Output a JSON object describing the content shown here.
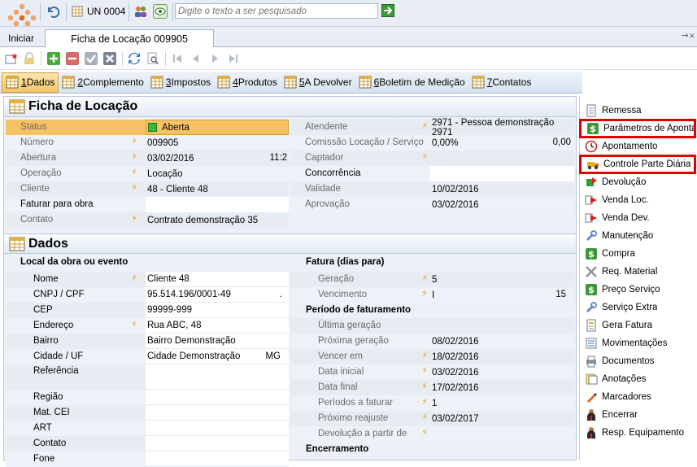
{
  "topbar": {
    "un_label": "UN 0004",
    "search_placeholder": "Digite o texto a ser pesquisado"
  },
  "tabs": {
    "start": "Iniciar",
    "active": "Ficha de Locação 009905",
    "right_arrow": "→"
  },
  "subtabs": [
    {
      "num": "1",
      "label": " Dados"
    },
    {
      "num": "2",
      "label": " Complemento"
    },
    {
      "num": "3",
      "label": " Impostos"
    },
    {
      "num": "4",
      "label": " Produtos"
    },
    {
      "num": "5",
      "label": " A Devolver"
    },
    {
      "num": "6",
      "label": " Boletim de Medição"
    },
    {
      "num": "7",
      "label": " Contatos"
    }
  ],
  "ficha": {
    "title": "Ficha de Locação",
    "left": [
      {
        "label": "Status",
        "value": "Aberta"
      },
      {
        "label": "Número",
        "value": "009905"
      },
      {
        "label": "Abertura",
        "value": "03/02/2016",
        "extra": "11:2"
      },
      {
        "label": "Operação",
        "value": "Locação"
      },
      {
        "label": "Cliente",
        "value": "48 - Cliente 48"
      },
      {
        "label": "Faturar para obra",
        "value": ""
      },
      {
        "label": "Contato",
        "value": "Contrato demonstração 35"
      }
    ],
    "right": [
      {
        "label": "Atendente",
        "value": "2971 - Pessoa demonstração 2971"
      },
      {
        "label": "Comissão Locação / Serviço",
        "value": "0,00%",
        "extra": "0,00"
      },
      {
        "label": "Captador",
        "value": ""
      },
      {
        "label": "Concorrência",
        "value": ""
      },
      {
        "label": "Validade",
        "value": "10/02/2016"
      },
      {
        "label": "Aprovação",
        "value": "03/02/2016"
      }
    ]
  },
  "dados": {
    "title": "Dados",
    "left_header": "Local da obra ou evento",
    "left": [
      {
        "label": "Nome",
        "value": "Cliente 48"
      },
      {
        "label": "CNPJ / CPF",
        "value": "95.514.196/0001-49",
        "extra": "."
      },
      {
        "label": "CEP",
        "value": "99999-999"
      },
      {
        "label": "Endereço",
        "value": "Rua ABC, 48"
      },
      {
        "label": "Bairro",
        "value": "Bairro Demonstração"
      },
      {
        "label": "Cidade / UF",
        "value": "Cidade Demonstração",
        "extra": "MG"
      },
      {
        "label": "Referência",
        "value": ""
      },
      {
        "label": "Região",
        "value": ""
      },
      {
        "label": "Mat. CEI",
        "value": ""
      },
      {
        "label": "ART",
        "value": ""
      },
      {
        "label": "Contato",
        "value": ""
      },
      {
        "label": "Fone",
        "value": ""
      }
    ],
    "right_header": "Fatura (dias para)",
    "right": [
      {
        "label": "Geração",
        "value": "5"
      },
      {
        "label": "Vencimento",
        "value": "I",
        "extra": "15"
      }
    ],
    "periodo_header": "Período de faturamento",
    "periodo": [
      {
        "label": "Última geração",
        "value": ""
      },
      {
        "label": "Próxima geração",
        "value": "08/02/2016"
      },
      {
        "label": "Vencer em",
        "value": "18/02/2016"
      },
      {
        "label": "Data inicial",
        "value": "03/02/2016"
      },
      {
        "label": "Data final",
        "value": "17/02/2016"
      },
      {
        "label": "Períodos a faturar",
        "value": "1"
      },
      {
        "label": "Próximo reajuste",
        "value": "03/02/2017"
      },
      {
        "label": "Devolução a partir de",
        "value": ""
      }
    ],
    "encerramento_header": "Encerramento"
  },
  "rightpanel": [
    {
      "label": "Remessa",
      "icon": "document-icon"
    },
    {
      "label": "Parâmetros de Apontam",
      "icon": "dollar-icon"
    },
    {
      "label": "Apontamento",
      "icon": "clock-icon"
    },
    {
      "label": "Controle Parte Diária",
      "icon": "truck-icon"
    },
    {
      "label": "Devolução",
      "icon": "return-icon"
    },
    {
      "label": "Venda Loc.",
      "icon": "arrow-red-icon"
    },
    {
      "label": "Venda Dev.",
      "icon": "arrow-red-icon"
    },
    {
      "label": "Manutenção",
      "icon": "wrench-icon"
    },
    {
      "label": "Compra",
      "icon": "dollar-icon"
    },
    {
      "label": "Req. Material",
      "icon": "tools-icon"
    },
    {
      "label": "Preço Serviço",
      "icon": "dollar-icon"
    },
    {
      "label": "Serviço Extra",
      "icon": "wrench-icon"
    },
    {
      "label": "Gera Fatura",
      "icon": "invoice-icon"
    },
    {
      "label": "Movimentações",
      "icon": "list-icon"
    },
    {
      "label": "Documentos",
      "icon": "print-icon"
    },
    {
      "label": "Anotações",
      "icon": "notes-icon"
    },
    {
      "label": "Marcadores",
      "icon": "marker-icon"
    },
    {
      "label": "Encerrar",
      "icon": "person-icon"
    },
    {
      "label": "Resp. Equipamento",
      "icon": "person-icon"
    }
  ],
  "colors": {
    "status_highlight": "#f9c46a",
    "section_header_bg": "#e3eaf4",
    "highlight_box": "#e00000"
  }
}
